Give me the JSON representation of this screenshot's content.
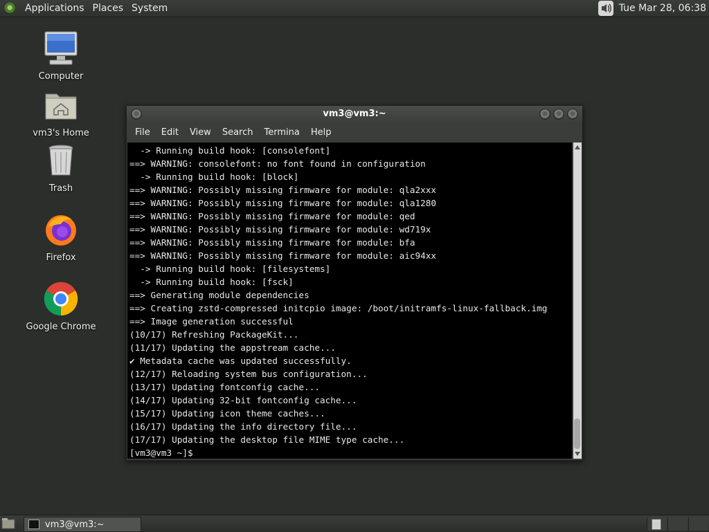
{
  "top_panel": {
    "menus": [
      "Applications",
      "Places",
      "System"
    ],
    "clock": "Tue Mar 28, 06:38",
    "icons": [
      "distro-logo-icon",
      "volume-icon"
    ]
  },
  "desktop": {
    "icons": [
      {
        "label": "Computer",
        "icon": "computer-icon"
      },
      {
        "label": "vm3's Home",
        "icon": "home-folder-icon"
      },
      {
        "label": "Trash",
        "icon": "trash-icon"
      },
      {
        "label": "Firefox",
        "icon": "firefox-icon"
      },
      {
        "label": "Google Chrome",
        "icon": "chrome-icon"
      }
    ]
  },
  "terminal": {
    "title": "vm3@vm3:~",
    "menu": [
      "File",
      "Edit",
      "View",
      "Search",
      "Termina",
      "Help"
    ],
    "lines": [
      "  -> Running build hook: [consolefont]",
      "==> WARNING: consolefont: no font found in configuration",
      "  -> Running build hook: [block]",
      "==> WARNING: Possibly missing firmware for module: qla2xxx",
      "==> WARNING: Possibly missing firmware for module: qla1280",
      "==> WARNING: Possibly missing firmware for module: qed",
      "==> WARNING: Possibly missing firmware for module: wd719x",
      "==> WARNING: Possibly missing firmware for module: bfa",
      "==> WARNING: Possibly missing firmware for module: aic94xx",
      "  -> Running build hook: [filesystems]",
      "  -> Running build hook: [fsck]",
      "==> Generating module dependencies",
      "==> Creating zstd-compressed initcpio image: /boot/initramfs-linux-fallback.img",
      "==> Image generation successful",
      "(10/17) Refreshing PackageKit...",
      "(11/17) Updating the appstream cache...",
      "✔ Metadata cache was updated successfully.",
      "(12/17) Reloading system bus configuration...",
      "(13/17) Updating fontconfig cache...",
      "(14/17) Updating 32-bit fontconfig cache...",
      "(15/17) Updating icon theme caches...",
      "(16/17) Updating the info directory file...",
      "(17/17) Updating the desktop file MIME type cache...",
      "[vm3@vm3 ~]$ "
    ]
  },
  "bottom_panel": {
    "task": "vm3@vm3:~",
    "workspaces": 3
  }
}
